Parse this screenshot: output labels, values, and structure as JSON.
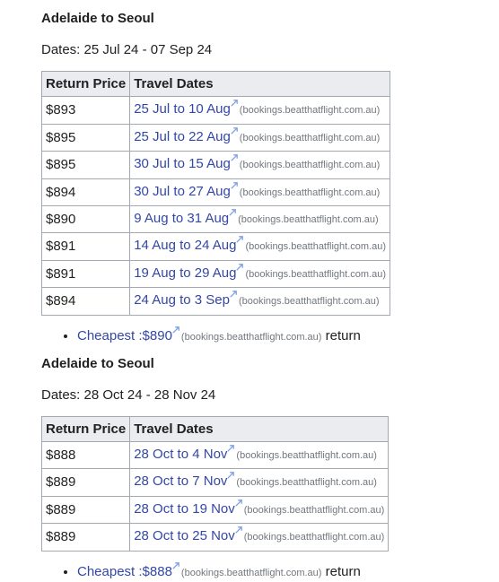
{
  "sections": [
    {
      "title": "Adelaide to Seoul",
      "dates_label": "Dates: 25 Jul 24 - 07 Sep 24",
      "headers": [
        "Return Price",
        "Travel Dates"
      ],
      "rows": [
        {
          "price": "$893",
          "dates": "25 Jul to 10 Aug",
          "domain": "(bookings.beatthatflight.com.au)"
        },
        {
          "price": "$895",
          "dates": "25 Jul to 22 Aug",
          "domain": "(bookings.beatthatflight.com.au)"
        },
        {
          "price": "$895",
          "dates": "30 Jul to 15 Aug",
          "domain": "(bookings.beatthatflight.com.au)"
        },
        {
          "price": "$894",
          "dates": "30 Jul to 27 Aug",
          "domain": "(bookings.beatthatflight.com.au)"
        },
        {
          "price": "$890",
          "dates": "9 Aug to 31 Aug",
          "domain": "(bookings.beatthatflight.com.au)"
        },
        {
          "price": "$891",
          "dates": "14 Aug to 24 Aug",
          "domain": "(bookings.beatthatflight.com.au)"
        },
        {
          "price": "$891",
          "dates": "19 Aug to 29 Aug",
          "domain": "(bookings.beatthatflight.com.au)"
        },
        {
          "price": "$894",
          "dates": "24 Aug to 3 Sep",
          "domain": "(bookings.beatthatflight.com.au)"
        }
      ],
      "cheapest": {
        "link": "Cheapest :$890",
        "domain": "(bookings.beatthatflight.com.au)",
        "suffix": "return"
      }
    },
    {
      "title": "Adelaide to Seoul",
      "dates_label": "Dates: 28 Oct 24 - 28 Nov 24",
      "headers": [
        "Return Price",
        "Travel Dates"
      ],
      "rows": [
        {
          "price": "$888",
          "dates": "28 Oct to 4 Nov",
          "domain": "(bookings.beatthatflight.com.au)"
        },
        {
          "price": "$889",
          "dates": "28 Oct to 7 Nov",
          "domain": "(bookings.beatthatflight.com.au)"
        },
        {
          "price": "$889",
          "dates": "28 Oct to 19 Nov",
          "domain": "(bookings.beatthatflight.com.au)"
        },
        {
          "price": "$889",
          "dates": "28 Oct to 25 Nov",
          "domain": "(bookings.beatthatflight.com.au)"
        }
      ],
      "cheapest": {
        "link": "Cheapest :$888",
        "domain": "(bookings.beatthatflight.com.au)",
        "suffix": "return"
      }
    }
  ],
  "colors": {
    "link": "#3347a5",
    "domain": "#72777d",
    "border": "#a2a9b1",
    "header_bg": "#eaecf0"
  },
  "icons": {
    "external": "external-link-icon"
  }
}
